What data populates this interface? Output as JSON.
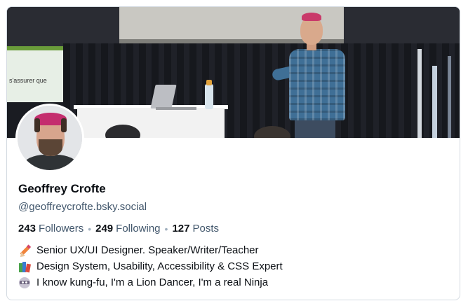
{
  "banner": {
    "slide_text": "s'assurer que"
  },
  "profile": {
    "display_name": "Geoffrey Crofte",
    "handle": "@geoffreycrofte.bsky.social",
    "stats": {
      "followers_count": "243",
      "followers_label": "Followers",
      "following_count": "249",
      "following_label": "Following",
      "posts_count": "127",
      "posts_label": "Posts"
    },
    "bio": [
      {
        "icon": "pencil-icon",
        "text": "Senior UX/UI Designer. Speaker/Writer/Teacher"
      },
      {
        "icon": "books-icon",
        "text": "Design System, Usability, Accessibility & CSS Expert"
      },
      {
        "icon": "ninja-icon",
        "text": "I know kung-fu, I'm a Lion Dancer, I'm a real Ninja"
      }
    ]
  },
  "colors": {
    "text_primary": "#0b0f14",
    "text_secondary": "#42576c",
    "border": "#d4dbe2"
  }
}
